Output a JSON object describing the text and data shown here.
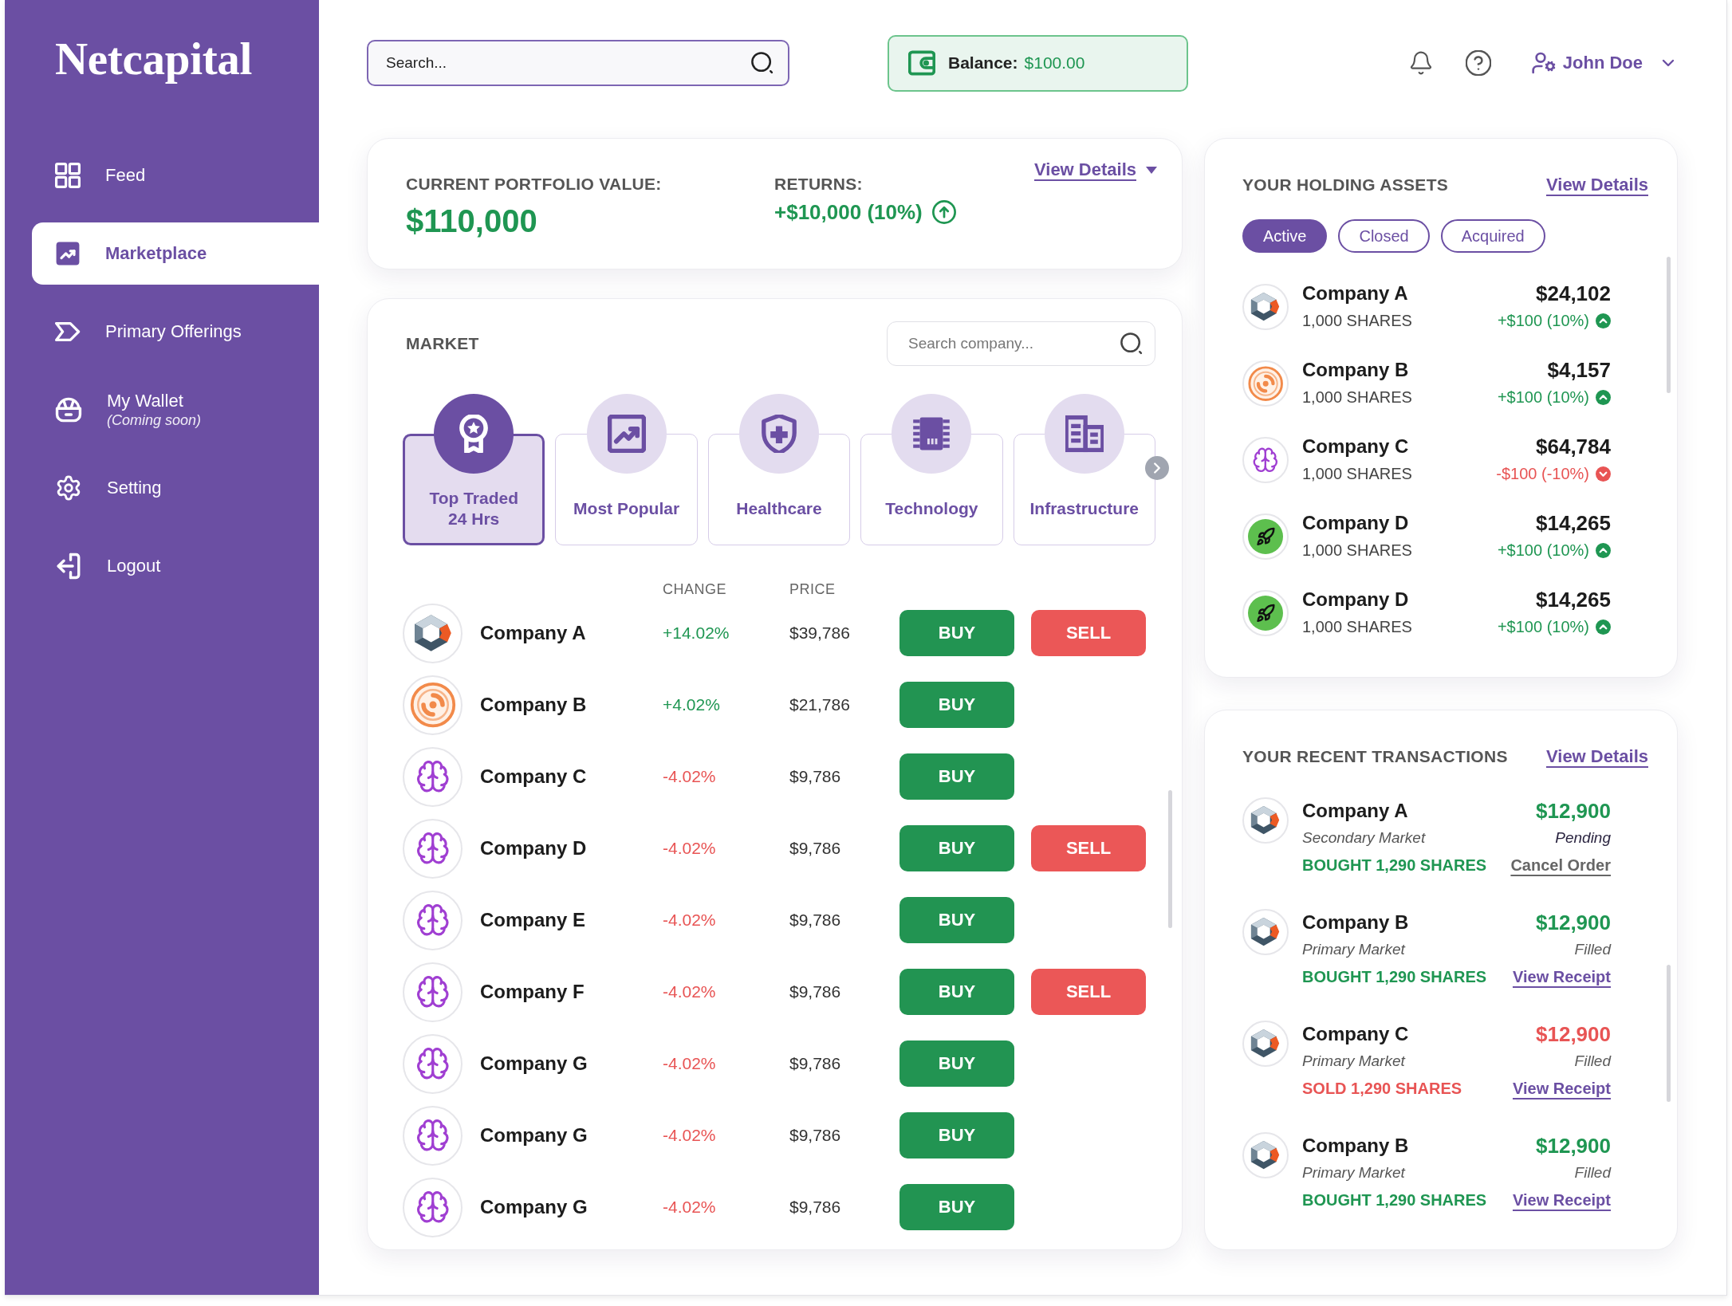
{
  "sidebar": {
    "logo": "Netcapital",
    "items": [
      {
        "label": "Feed",
        "selected": false
      },
      {
        "label": "Marketplace",
        "selected": true
      },
      {
        "label": "Primary Offerings",
        "selected": false
      },
      {
        "label": "My Wallet",
        "note": "(Coming soon)",
        "selected": false
      },
      {
        "label": "Setting",
        "selected": false
      },
      {
        "label": "Logout",
        "selected": false
      }
    ]
  },
  "header": {
    "search": {
      "placeholder": "Search..."
    },
    "balance": {
      "label": "Balance:",
      "value": "$100.00"
    },
    "user": {
      "name": "John Doe"
    }
  },
  "portfolio": {
    "value_label": "CURRENT PORTFOLIO VALUE:",
    "value": "$110,000",
    "returns_label": "RETURNS:",
    "returns": "+$10,000 (10%)",
    "returns_positive": true,
    "details_link": "View Details"
  },
  "market": {
    "title": "MARKET",
    "search": {
      "placeholder": "Search company..."
    },
    "categories": [
      {
        "label": "Top Traded 24 Hrs",
        "selected": true
      },
      {
        "label": "Most Popular",
        "selected": false
      },
      {
        "label": "Healthcare",
        "selected": false
      },
      {
        "label": "Technology",
        "selected": false
      },
      {
        "label": "Infrastructure",
        "selected": false
      }
    ],
    "columns": [
      "CHANGE",
      "PRICE"
    ],
    "rows": [
      {
        "company": "Company A",
        "change": "+14.02%",
        "positive": true,
        "price": "$39,786",
        "actions": [
          {
            "label": "BUY",
            "kind": "buy"
          },
          {
            "label": "SELL",
            "kind": "sell"
          }
        ]
      },
      {
        "company": "Company B",
        "change": "+4.02%",
        "positive": true,
        "price": "$21,786",
        "actions": [
          {
            "label": "BUY",
            "kind": "buy"
          }
        ]
      },
      {
        "company": "Company C",
        "change": "-4.02%",
        "positive": false,
        "price": "$9,786",
        "actions": [
          {
            "label": "BUY",
            "kind": "buy"
          }
        ]
      },
      {
        "company": "Company D",
        "change": "-4.02%",
        "positive": false,
        "price": "$9,786",
        "actions": [
          {
            "label": "BUY",
            "kind": "buy"
          },
          {
            "label": "SELL",
            "kind": "sell"
          }
        ]
      },
      {
        "company": "Company E",
        "change": "-4.02%",
        "positive": false,
        "price": "$9,786",
        "actions": [
          {
            "label": "BUY",
            "kind": "buy"
          }
        ]
      },
      {
        "company": "Company F",
        "change": "-4.02%",
        "positive": false,
        "price": "$9,786",
        "actions": [
          {
            "label": "BUY",
            "kind": "buy"
          },
          {
            "label": "SELL",
            "kind": "sell"
          }
        ]
      },
      {
        "company": "Company G",
        "change": "-4.02%",
        "positive": false,
        "price": "$9,786",
        "actions": [
          {
            "label": "BUY",
            "kind": "buy"
          }
        ]
      },
      {
        "company": "Company G",
        "change": "-4.02%",
        "positive": false,
        "price": "$9,786",
        "actions": [
          {
            "label": "BUY",
            "kind": "buy"
          }
        ]
      },
      {
        "company": "Company G",
        "change": "-4.02%",
        "positive": false,
        "price": "$9,786",
        "actions": [
          {
            "label": "BUY",
            "kind": "buy"
          }
        ]
      }
    ]
  },
  "holdings": {
    "title": "YOUR HOLDING ASSETS",
    "details_link": "View Details",
    "tabs": [
      {
        "label": "Active",
        "selected": true
      },
      {
        "label": "Closed",
        "selected": false
      },
      {
        "label": "Acquired",
        "selected": false
      }
    ],
    "items": [
      {
        "company": "Company A",
        "shares": "1,000 SHARES",
        "value": "$24,102",
        "change": "+$100 (10%)",
        "positive": true
      },
      {
        "company": "Company B",
        "shares": "1,000 SHARES",
        "value": "$4,157",
        "change": "+$100 (10%)",
        "positive": true
      },
      {
        "company": "Company C",
        "shares": "1,000 SHARES",
        "value": "$64,784",
        "change": "-$100 (-10%)",
        "positive": false
      },
      {
        "company": "Company D",
        "shares": "1,000 SHARES",
        "value": "$14,265",
        "change": "+$100 (10%)",
        "positive": true
      },
      {
        "company": "Company D",
        "shares": "1,000 SHARES",
        "value": "$14,265",
        "change": "+$100 (10%)",
        "positive": true
      }
    ]
  },
  "transactions": {
    "title": "YOUR RECENT TRANSACTIONS",
    "details_link": "View Details",
    "items": [
      {
        "company": "Company A",
        "amount": "$12,900",
        "market": "Secondary Market",
        "status": "Pending",
        "pending": true,
        "action": "BOUGHT 1,290 SHARES",
        "kind": "buy",
        "link": {
          "label": "Cancel Order",
          "kind": "cancel"
        }
      },
      {
        "company": "Company B",
        "amount": "$12,900",
        "market": "Primary Market",
        "status": "Filled",
        "pending": false,
        "action": "BOUGHT 1,290 SHARES",
        "kind": "buy",
        "link": {
          "label": "View Receipt",
          "kind": "receipt"
        }
      },
      {
        "company": "Company C",
        "amount": "$12,900",
        "market": "Primary Market",
        "status": "Filled",
        "pending": false,
        "action": "SOLD 1,290 SHARES",
        "kind": "sell",
        "link": {
          "label": "View Receipt",
          "kind": "receipt"
        }
      },
      {
        "company": "Company B",
        "amount": "$12,900",
        "market": "Primary Market",
        "status": "Filled",
        "pending": false,
        "action": "BOUGHT 1,290 SHARES",
        "kind": "buy",
        "link": {
          "label": "View Receipt",
          "kind": "receipt"
        }
      }
    ]
  }
}
